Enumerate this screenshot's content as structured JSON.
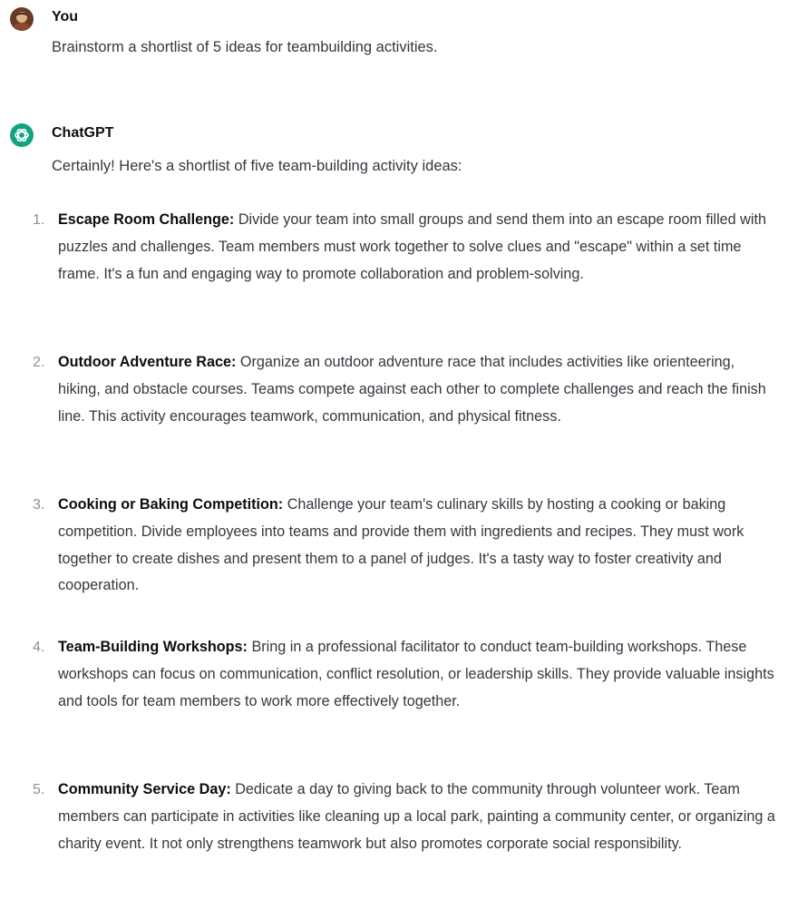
{
  "conversation": {
    "user": {
      "author": "You",
      "message": "Brainstorm a shortlist of 5 ideas for teambuilding activities."
    },
    "assistant": {
      "author": "ChatGPT",
      "brand_color": "#10a37f",
      "intro": "Certainly! Here's a shortlist of five team-building activity ideas:",
      "ideas": [
        {
          "number": "1.",
          "title": "Escape Room Challenge:",
          "text": "Divide your team into small groups and send them into an escape room filled with puzzles and challenges. Team members must work together to solve clues and \"escape\" within a set time frame. It's a fun and engaging way to promote collaboration and problem-solving."
        },
        {
          "number": "2.",
          "title": "Outdoor Adventure Race:",
          "text": "Organize an outdoor adventure race that includes activities like orienteering, hiking, and obstacle courses. Teams compete against each other to complete challenges and reach the finish line. This activity encourages teamwork, communication, and physical fitness."
        },
        {
          "number": "3.",
          "title": "Cooking or Baking Competition:",
          "text": "Challenge your team's culinary skills by hosting a cooking or baking competition. Divide employees into teams and provide them with ingredients and recipes. They must work together to create dishes and present them to a panel of judges. It's a tasty way to foster creativity and cooperation."
        },
        {
          "number": "4.",
          "title": "Team-Building Workshops:",
          "text": "Bring in a professional facilitator to conduct team-building workshops. These workshops can focus on communication, conflict resolution, or leadership skills. They provide valuable insights and tools for team members to work more effectively together."
        },
        {
          "number": "5.",
          "title": "Community Service Day:",
          "text": "Dedicate a day to giving back to the community through volunteer work. Team members can participate in activities like cleaning up a local park, painting a community center, or organizing a charity event. It not only strengthens teamwork but also promotes corporate social responsibility."
        }
      ]
    }
  }
}
